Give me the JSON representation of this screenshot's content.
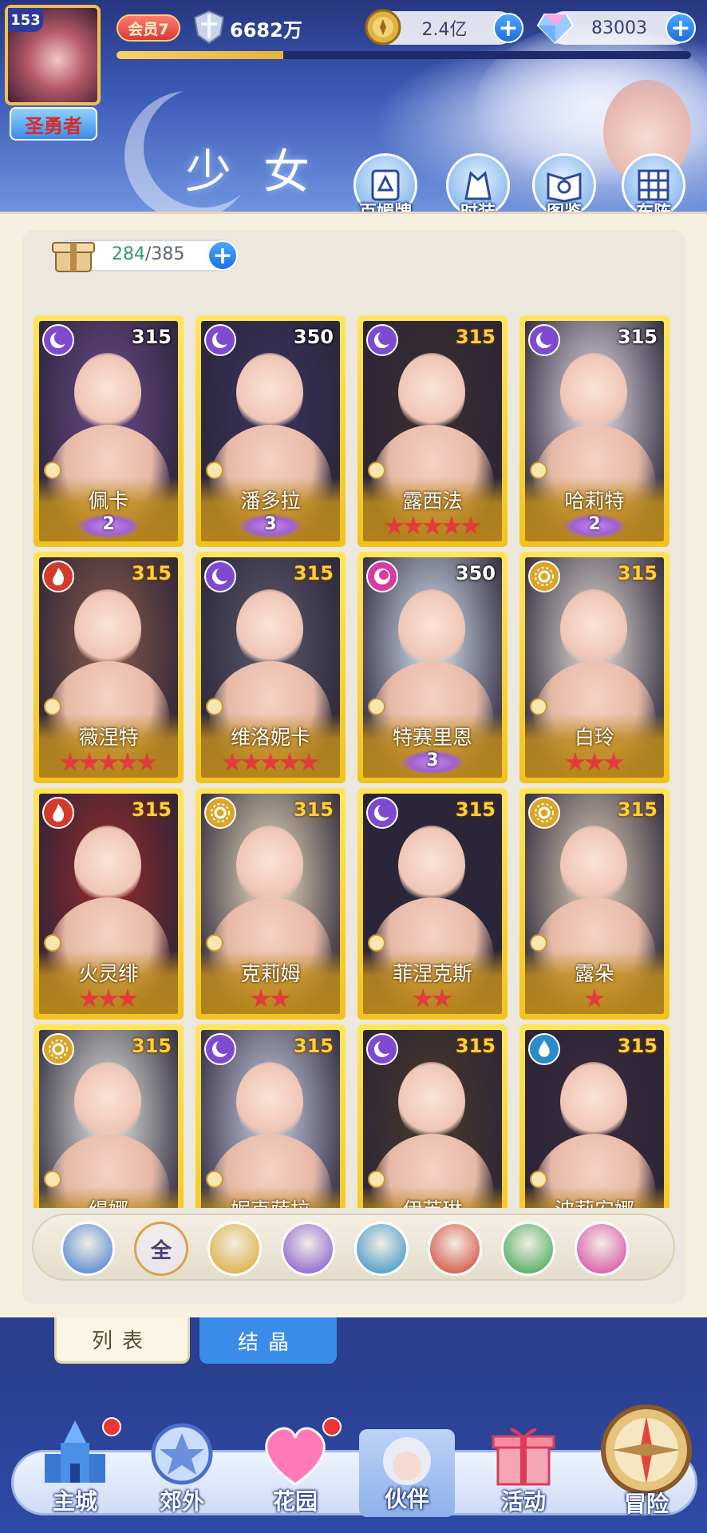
{
  "player": {
    "level": "153",
    "title": "圣勇者",
    "vip": "会员7",
    "power": "6682万",
    "exp_fraction": 0.29
  },
  "currencies": {
    "gold": "2.4亿",
    "gems": "83003"
  },
  "page_title": "少女",
  "top_menu": [
    "百媚牌",
    "时装",
    "图鉴",
    "布阵"
  ],
  "capacity": {
    "current": "284",
    "max": "/385"
  },
  "cards": [
    {
      "name": "佩卡",
      "power": "315",
      "element": "moon",
      "stars": 0,
      "wings": "2",
      "gold_power": false
    },
    {
      "name": "潘多拉",
      "power": "350",
      "element": "moon",
      "stars": 0,
      "wings": "3",
      "gold_power": false
    },
    {
      "name": "露西法",
      "power": "315",
      "element": "moon",
      "stars": 5,
      "wings": "",
      "gold_power": true
    },
    {
      "name": "哈莉特",
      "power": "315",
      "element": "moon",
      "stars": 0,
      "wings": "2",
      "gold_power": false
    },
    {
      "name": "薇涅特",
      "power": "315",
      "element": "fire",
      "stars": 5,
      "wings": "",
      "gold_power": true
    },
    {
      "name": "维洛妮卡",
      "power": "315",
      "element": "moon",
      "stars": 5,
      "wings": "",
      "gold_power": true
    },
    {
      "name": "特赛里恩",
      "power": "350",
      "element": "heart",
      "stars": 0,
      "wings": "3",
      "gold_power": false
    },
    {
      "name": "白玲",
      "power": "315",
      "element": "sun",
      "stars": 3,
      "wings": "",
      "gold_power": true
    },
    {
      "name": "火灵绯",
      "power": "315",
      "element": "fire",
      "stars": 3,
      "wings": "",
      "gold_power": true
    },
    {
      "name": "克莉姆",
      "power": "315",
      "element": "sun",
      "stars": 2,
      "wings": "",
      "gold_power": true
    },
    {
      "name": "菲涅克斯",
      "power": "315",
      "element": "moon",
      "stars": 2,
      "wings": "",
      "gold_power": true
    },
    {
      "name": "露朵",
      "power": "315",
      "element": "sun",
      "stars": 1,
      "wings": "",
      "gold_power": true
    },
    {
      "name": "缇娜",
      "power": "315",
      "element": "sun",
      "stars": 0,
      "wings": "",
      "gold_power": true
    },
    {
      "name": "妮克萨拉",
      "power": "315",
      "element": "moon",
      "stars": 0,
      "wings": "",
      "gold_power": true
    },
    {
      "name": "伊芙琳",
      "power": "315",
      "element": "moon",
      "stars": 0,
      "wings": "",
      "gold_power": true
    },
    {
      "name": "波莉安娜",
      "power": "315",
      "element": "water",
      "stars": 0,
      "wings": "",
      "gold_power": true
    }
  ],
  "filters": [
    {
      "label": "",
      "element": "wind-up",
      "color": "#3a7ad6"
    },
    {
      "label": "全",
      "element": "all",
      "color": "#e9e4f6"
    },
    {
      "label": "",
      "element": "sun",
      "color": "#d9a628"
    },
    {
      "label": "",
      "element": "moon",
      "color": "#7e4bd0"
    },
    {
      "label": "",
      "element": "water",
      "color": "#2a8cc8"
    },
    {
      "label": "",
      "element": "fire",
      "color": "#d23a2a"
    },
    {
      "label": "",
      "element": "wind",
      "color": "#2fa34a"
    },
    {
      "label": "",
      "element": "heart",
      "color": "#d63ca0"
    }
  ],
  "tabs": {
    "list": "列表",
    "crystal": "结晶"
  },
  "nav": [
    "主城",
    "郊外",
    "花园",
    "伙伴",
    "活动",
    "冒险"
  ],
  "element_colors": {
    "moon": "#7e4bd0",
    "fire": "#d23a2a",
    "sun": "#d9a628",
    "heart": "#d63ca0",
    "water": "#2a8cc8",
    "wind": "#2fa34a"
  }
}
